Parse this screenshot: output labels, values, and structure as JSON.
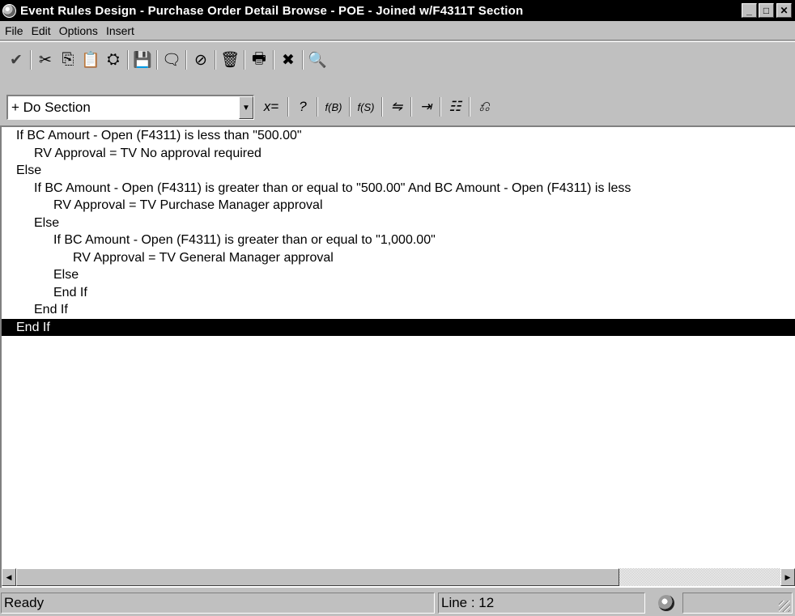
{
  "window": {
    "title": "Event Rules Design - Purchase Order Detail Browse - POE - Joined w/F4311T Section",
    "minimize": "_",
    "maximize": "□",
    "close": "✕"
  },
  "menu": [
    {
      "label": "File"
    },
    {
      "label": "Edit"
    },
    {
      "label": "Options"
    },
    {
      "label": "Insert"
    }
  ],
  "toolbar1": [
    {
      "name": "checkmark-icon",
      "glyph": "✔"
    },
    {
      "name": "cut-icon",
      "glyph": "✂"
    },
    {
      "name": "copy-icon",
      "glyph": "⎘"
    },
    {
      "name": "paste-icon",
      "glyph": "📋"
    },
    {
      "name": "paste-special-icon",
      "glyph": "⛭"
    },
    {
      "name": "save-icon",
      "glyph": "💾"
    },
    {
      "name": "comment-icon",
      "glyph": "🗨"
    },
    {
      "name": "disable-icon",
      "glyph": "⊘"
    },
    {
      "name": "delete-icon",
      "glyph": "🗑"
    },
    {
      "name": "print-icon",
      "glyph": "🖶"
    },
    {
      "name": "cancel-icon",
      "glyph": "✖"
    },
    {
      "name": "print-preview-icon",
      "glyph": "🔍"
    }
  ],
  "combo": {
    "value": "+ Do Section",
    "arrow": "▼"
  },
  "toolbar2": [
    {
      "name": "assignment-icon",
      "glyph": "x="
    },
    {
      "name": "if-while-icon",
      "glyph": "?"
    },
    {
      "name": "business-function-icon",
      "glyph": "f(B)"
    },
    {
      "name": "system-function-icon",
      "glyph": "f(S)"
    },
    {
      "name": "form-interconnect-icon",
      "glyph": "⇋"
    },
    {
      "name": "else-icon",
      "glyph": "⇥"
    },
    {
      "name": "variables-icon",
      "glyph": "☷"
    },
    {
      "name": "table-io-icon",
      "glyph": "⎌"
    }
  ],
  "code": {
    "lines": [
      {
        "text": "If BC Amourt - Open (F4311) is less than \"500.00\"",
        "indent": 0,
        "selected": false
      },
      {
        "text": "RV Approval = TV No approval required",
        "indent": 1,
        "selected": false
      },
      {
        "text": "Else",
        "indent": 0,
        "selected": false
      },
      {
        "text": "If BC Amount - Open (F4311) is greater than or equal to \"500.00\"   And BC Amount - Open (F4311) is less",
        "indent": 1,
        "selected": false
      },
      {
        "text": "RV Approval = TV Purchase Manager approval",
        "indent": 2,
        "selected": false
      },
      {
        "text": "Else",
        "indent": 1,
        "selected": false
      },
      {
        "text": "If BC Amount - Open (F4311) is greater than or equal to \"1,000.00\"",
        "indent": 2,
        "selected": false
      },
      {
        "text": "RV Approval = TV General Manager approval",
        "indent": 3,
        "selected": false
      },
      {
        "text": "Else",
        "indent": 2,
        "selected": false
      },
      {
        "text": "End If",
        "indent": 2,
        "selected": false
      },
      {
        "text": "End If",
        "indent": 1,
        "selected": false
      },
      {
        "text": "End If",
        "indent": 0,
        "selected": true
      }
    ]
  },
  "scroll": {
    "left_arrow": "◀",
    "right_arrow": "▶"
  },
  "status": {
    "state": "Ready",
    "line": "Line :  12"
  }
}
